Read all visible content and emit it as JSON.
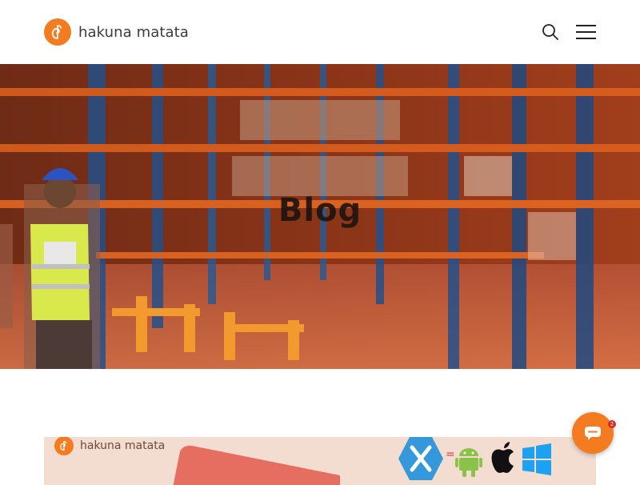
{
  "brand": {
    "name": "hakuna matata",
    "accent": "#f47b20"
  },
  "header": {
    "search_icon": "search-icon",
    "menu_icon": "hamburger-menu-icon"
  },
  "hero": {
    "title": "Blog"
  },
  "card": {
    "brand_text": "hakuna matata",
    "equals": "=",
    "icons": [
      "xamarin-icon",
      "android-icon",
      "apple-icon",
      "windows-icon"
    ]
  },
  "chat": {
    "badge": "2",
    "icon": "chat-icon"
  }
}
